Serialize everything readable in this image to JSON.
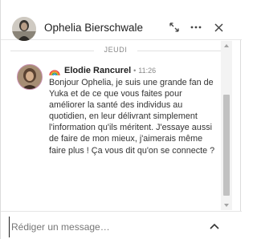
{
  "header": {
    "contact_name": "Ophelia Bierschwale",
    "icons": {
      "expand": "expand-icon",
      "more": "more-icon",
      "close": "close-icon"
    }
  },
  "conversation": {
    "day_label": "JEUDI",
    "message": {
      "sender_name": "Elodie Rancurel",
      "sender_icon": "rainbow-icon",
      "time": "11:26",
      "text": "Bonjour Ophelia, je suis une grande fan de Yuka et de ce que vous faites pour améliorer la santé des individus au quotidien, en leur délivrant simplement l'information qu'ils méritent. J'essaye aussi de faire de mon mieux, j'aimerais même faire plus ! Ça vous dit qu'on se connecte ?"
    }
  },
  "compose": {
    "placeholder": "Rédiger un message…",
    "value": ""
  }
}
